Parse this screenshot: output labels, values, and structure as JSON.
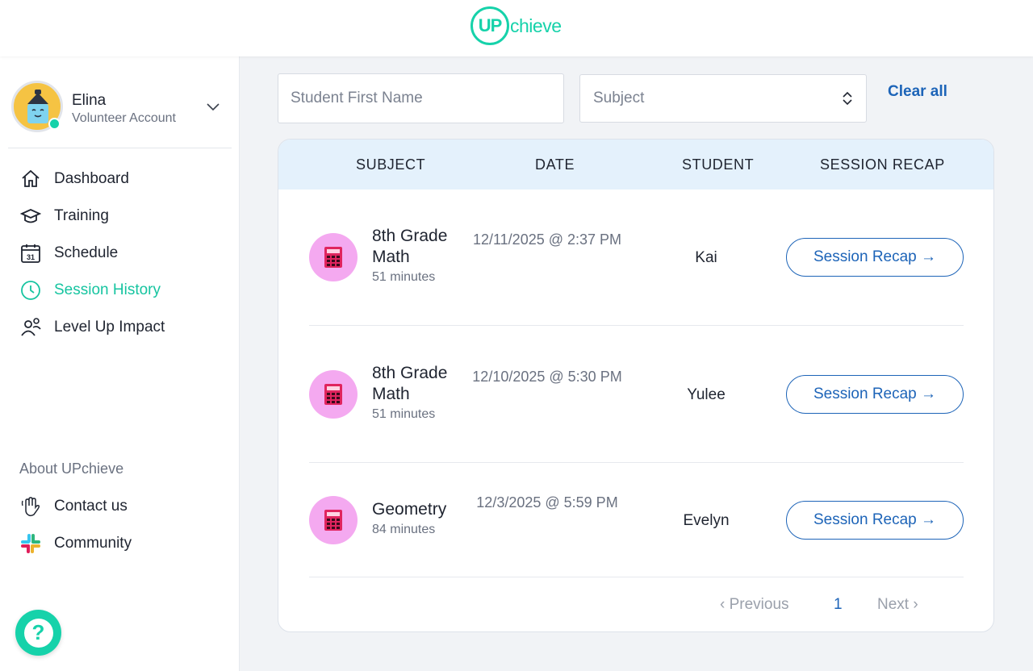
{
  "app": {
    "logo_up": "UP",
    "logo_rest": "chieve"
  },
  "profile": {
    "name": "Elina",
    "role": "Volunteer Account"
  },
  "nav": [
    {
      "label": "Dashboard",
      "icon": "home-icon"
    },
    {
      "label": "Training",
      "icon": "graduation-cap-icon"
    },
    {
      "label": "Schedule",
      "icon": "calendar-icon",
      "icon_text": "31"
    },
    {
      "label": "Session History",
      "icon": "clock-icon",
      "active": true
    },
    {
      "label": "Level Up Impact",
      "icon": "people-icon"
    }
  ],
  "about": {
    "heading": "About UPchieve",
    "links": [
      {
        "label": "Contact us",
        "icon": "waving-hand-icon"
      },
      {
        "label": "Community",
        "icon": "slack-icon"
      }
    ]
  },
  "help": {
    "label": "?"
  },
  "filters": {
    "student_placeholder": "Student First Name",
    "subject_value": "Subject",
    "clear_all": "Clear all"
  },
  "table": {
    "columns": [
      "SUBJECT",
      "DATE",
      "STUDENT",
      "SESSION RECAP"
    ],
    "rows": [
      {
        "subject": "8th Grade Math",
        "duration": "51 minutes",
        "date": "12/11/2025 @ 2:37 PM",
        "student": "Kai",
        "action": "Session Recap →"
      },
      {
        "subject": "8th Grade Math",
        "duration": "51 minutes",
        "date": "12/10/2025 @ 5:30 PM",
        "student": "Yulee",
        "action": "Session Recap →"
      },
      {
        "subject": "Geometry",
        "duration": "84 minutes",
        "date": "12/3/2025 @ 5:59 PM",
        "student": "Evelyn",
        "action": "Session Recap →"
      }
    ]
  },
  "pagination": {
    "previous": "Previous",
    "page": "1",
    "next": "Next"
  },
  "colors": {
    "brand": "#16d2aa",
    "link": "#1d64b8",
    "header_bg": "#e4f1fc",
    "subject_icon_bg": "#f4a9f0"
  }
}
